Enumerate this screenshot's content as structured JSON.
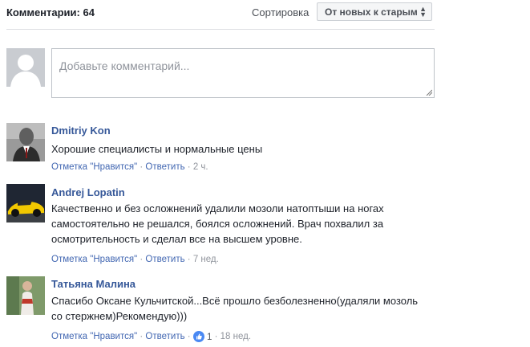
{
  "header": {
    "comments_count_label": "Комментарии: 64",
    "sort_label": "Сортировка",
    "sort_selected": "От новых к старым"
  },
  "composer": {
    "placeholder": "Добавьте комментарий..."
  },
  "comments": [
    {
      "author": "Dmitriy Kon",
      "text": "Хорошие специалисты и нормальные цены",
      "like_label": "Отметка \"Нравится\"",
      "reply_label": "Ответить",
      "time": "2 ч."
    },
    {
      "author": "Andrej Lopatin",
      "text": "Качественно и без осложнений удалили мозоли натоптыши на ногах самостоятельно не решался, боялся осложнений. Врач похвалил за осмотрительность и сделал все на высшем уровне.",
      "like_label": "Отметка \"Нравится\"",
      "reply_label": "Ответить",
      "time": "7 нед."
    },
    {
      "author": "Татьяна Малина",
      "text": "Спасибо Оксане Кульчитской...Всё прошло безболезненно(удаляли мозоль со стержнем)Рекомендую)))",
      "like_label": "Отметка \"Нравится\"",
      "reply_label": "Ответить",
      "reactions_count": "1",
      "time": "18 нед."
    }
  ],
  "colors": {
    "link": "#4267b2",
    "author": "#365899",
    "meta": "#90949c",
    "like_reaction": "#4a89f3"
  },
  "icons": {
    "sort": "sort-arrows-icon",
    "reaction": "thumbs-up-icon",
    "resize": "resize-grip-icon"
  }
}
